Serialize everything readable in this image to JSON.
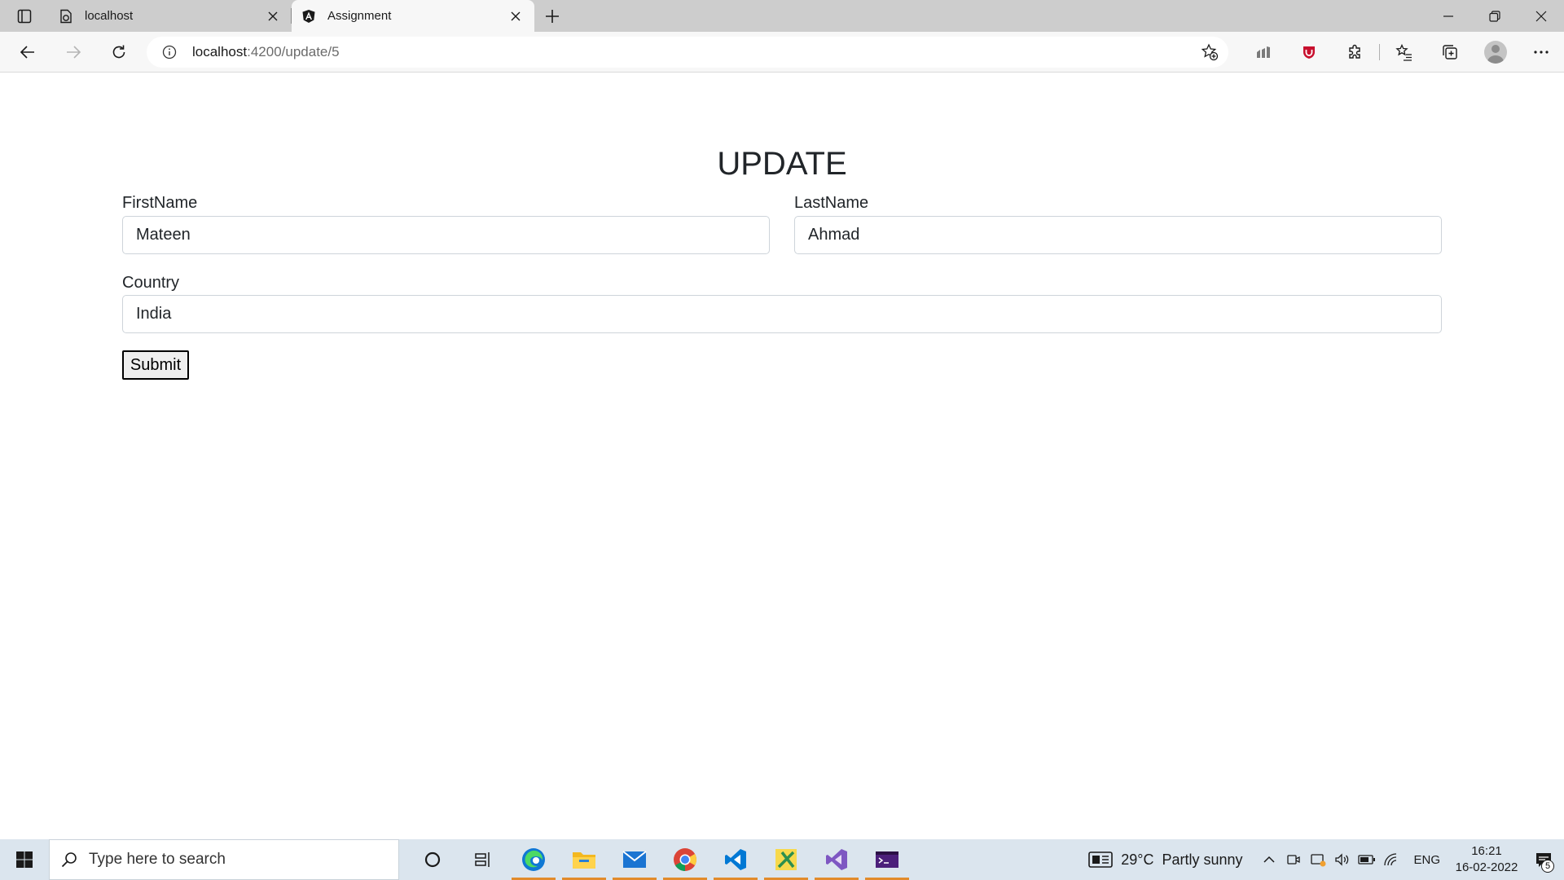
{
  "browser": {
    "tabs": [
      {
        "title": "localhost",
        "active": false
      },
      {
        "title": "Assignment",
        "active": true
      }
    ],
    "url_host": "localhost",
    "url_path": ":4200/update/5"
  },
  "page": {
    "heading": "UPDATE",
    "firstname": {
      "label": "FirstName",
      "value": "Mateen"
    },
    "lastname": {
      "label": "LastName",
      "value": "Ahmad"
    },
    "country": {
      "label": "Country",
      "value": "India"
    },
    "submit_label": "Submit"
  },
  "taskbar": {
    "search_placeholder": "Type here to search",
    "weather_temp": "29°C",
    "weather_desc": "Partly sunny",
    "language": "ENG",
    "time": "16:21",
    "date": "16-02-2022",
    "notification_count": "5"
  }
}
